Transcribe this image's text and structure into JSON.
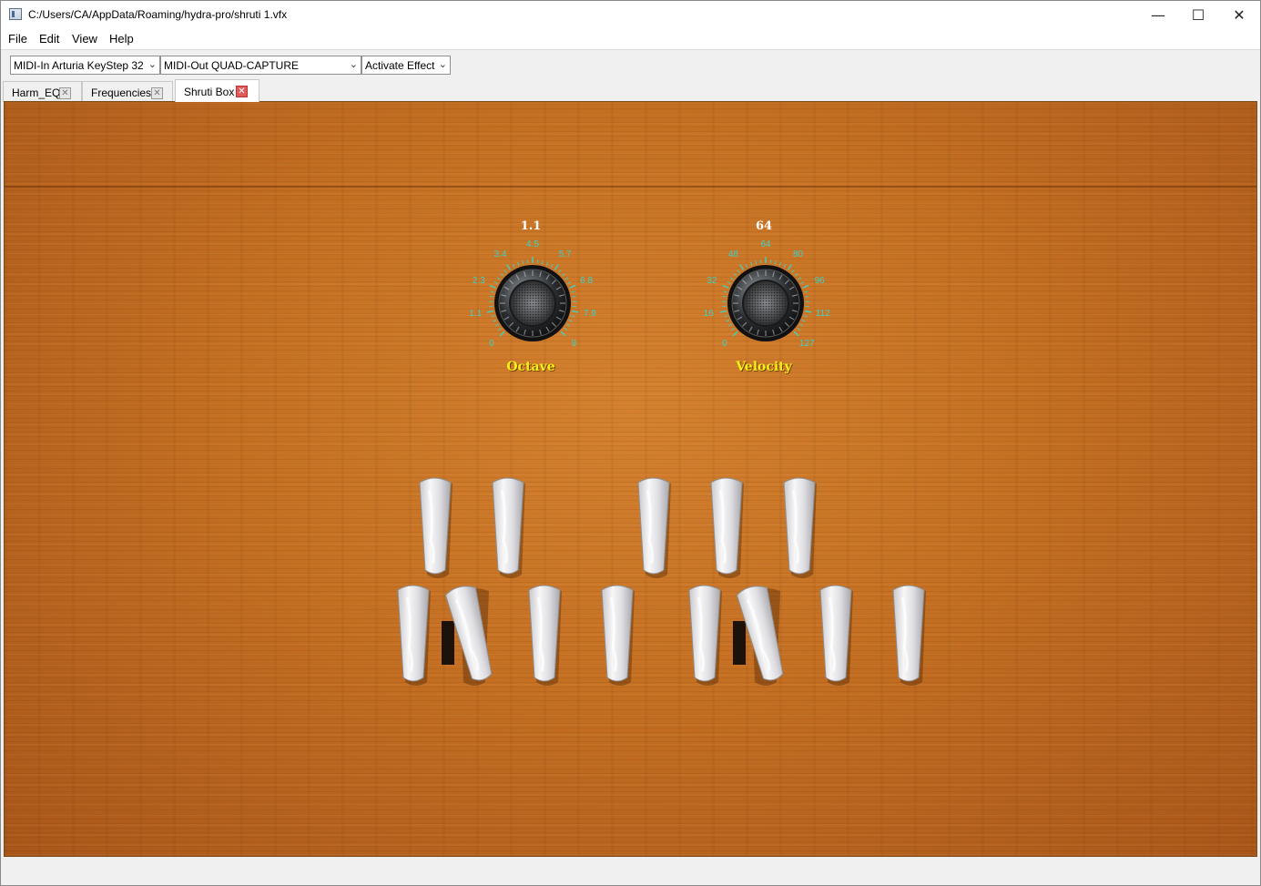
{
  "window": {
    "title": "C:/Users/CA/AppData/Roaming/hydra-pro/shruti 1.vfx",
    "minimize_glyph": "—",
    "maximize_glyph": "☐",
    "close_glyph": "✕"
  },
  "menu": {
    "items": [
      {
        "label": "File"
      },
      {
        "label": "Edit"
      },
      {
        "label": "View"
      },
      {
        "label": "Help"
      }
    ]
  },
  "toolbar": {
    "midi_in": "MIDI-In Arturia KeyStep 32",
    "midi_out": "MIDI-Out QUAD-CAPTURE",
    "effect": "Activate Effect",
    "dropdown_icon": "chevron-down-icon"
  },
  "tabs": [
    {
      "label": "Harm_EQ",
      "active": false
    },
    {
      "label": "Frequencies",
      "active": false
    },
    {
      "label": "Shruti Box",
      "active": true
    }
  ],
  "knobs": {
    "octave": {
      "title": "Octave",
      "value": "1.1",
      "ticks": [
        "0",
        "1.1",
        "2.3",
        "3.4",
        "4.5",
        "5.7",
        "6.8",
        "7.9",
        "9"
      ]
    },
    "velocity": {
      "title": "Velocity",
      "value": "64",
      "ticks": [
        "0",
        "16",
        "32",
        "48",
        "64",
        "80",
        "96",
        "112",
        "127"
      ]
    }
  },
  "keys": {
    "upper_row_count": 5,
    "lower_row_count": 8,
    "pressed_lower_keys": [
      1,
      5
    ],
    "color": "#e8e8ea"
  },
  "colors": {
    "wood": "#c46f22",
    "knob_title": "#f6ef1a",
    "tick": "#3fd1c4"
  }
}
